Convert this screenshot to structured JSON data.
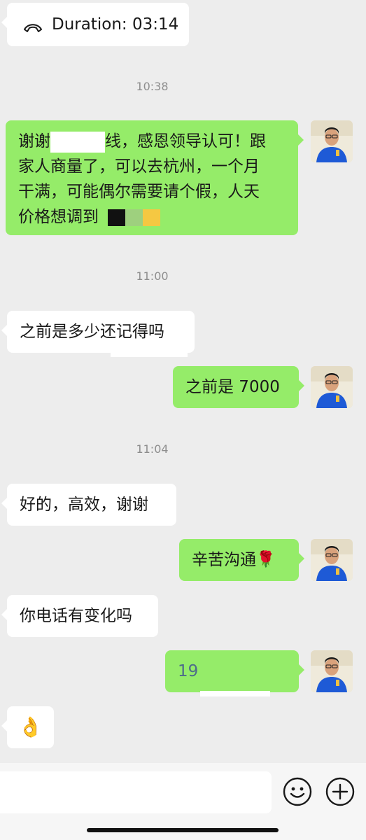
{
  "call": {
    "icon": "phone-hangup-icon",
    "label": "Duration: 03:14"
  },
  "timestamps": [
    "10:38",
    "11:00",
    "11:04"
  ],
  "messages": [
    {
      "side": "out",
      "lines": [
        "谢谢",
        "线，感恩领导认可！跟",
        "家人商量了，可以去杭州，一个月",
        "干满，可能偶尔需要请个假，人天",
        "价格想调到"
      ],
      "redacted": true
    },
    {
      "side": "in",
      "text": "之前是多少还记得吗"
    },
    {
      "side": "out",
      "text": "之前是 7000"
    },
    {
      "side": "in",
      "text": "好的，高效，谢谢"
    },
    {
      "side": "out",
      "text": "辛苦沟通",
      "emoji": "🌹"
    },
    {
      "side": "in",
      "text": "你电话有变化吗"
    },
    {
      "side": "out",
      "text": "19",
      "redacted": true
    },
    {
      "side": "in",
      "emoji": "👌"
    }
  ],
  "swatch_colors": [
    "#111111",
    "#9ed07e",
    "#f5c842"
  ],
  "colors": {
    "background": "#ededed",
    "outgoing_bubble": "#95ec69",
    "incoming_bubble": "#ffffff",
    "timestamp": "#8e8e8e"
  },
  "toolbar": {
    "emoji_icon": "smiley-face-icon",
    "add_icon": "plus-circle-icon"
  }
}
